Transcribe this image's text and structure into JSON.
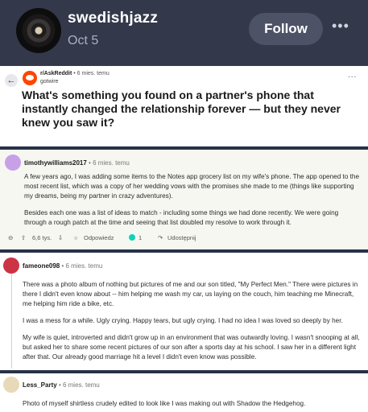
{
  "header": {
    "username": "swedishjazz",
    "date": "Oct 5",
    "follow_label": "Follow",
    "more_icon": "more-horizontal-icon"
  },
  "post": {
    "subreddit": "r/AskReddit",
    "age": "• 6 mies. temu",
    "author": "gotwire",
    "title": "What's something you found on a partner's phone that instantly changed the relationship forever — but they never knew you saw it?",
    "more": "..."
  },
  "comments": [
    {
      "user": "timothywilliams2017",
      "time": "• 6 mies. temu",
      "avatar_color": "#c8a0e8",
      "paragraphs": [
        "A few years ago, I was adding some items to the Notes app grocery list on my wife's phone. The app opened to the most recent list, which was a copy of her wedding vows with the promises she made to me (things like supporting my dreams, being my partner in crazy adventures).",
        "Besides each one was a list of ideas to match - including some things we had done recently. We were going through a rough patch at the time and seeing that list doubled my resolve to work through it."
      ],
      "actions": {
        "votes": "6,6 tys.",
        "reply": "Odpowiedz",
        "awards": "1",
        "share": "Udostępnij"
      }
    },
    {
      "user": "fameone098",
      "time": "• 6 mies. temu",
      "avatar_color": "#cc3344",
      "paragraphs": [
        "There was a photo album of nothing but pictures of me and our son titled, \"My Perfect Men.\" There were pictures in there I didn't even know about -- him helping me wash my car, us laying on the couch, him teaching me Minecraft, me helping him ride a bike, etc.",
        "I was a mess for a while. Ugly crying. Happy tears, but ugly crying. I had no idea I was loved so deeply by her.",
        "My wife is quiet, introverted and didn't grow up in an environment that was outwardly loving. I wasn't snooping at all, but asked her to share some recent pictures of our son after a sports day at his school. I saw her in a different light after that. Our already good marriage hit a level I didn't even know was possible."
      ]
    },
    {
      "user": "Less_Party",
      "time": "• 6 mies. temu",
      "avatar_color": "#e8d9b8",
      "paragraphs": [
        "Photo of myself shirtless crudely edited to look like I was making out with Shadow the Hedgehog."
      ]
    }
  ],
  "colors": {
    "header_bg": "#34384b",
    "separator": "#263247",
    "award": "#0dd3bb",
    "subreddit_icon": "#ff4500"
  }
}
